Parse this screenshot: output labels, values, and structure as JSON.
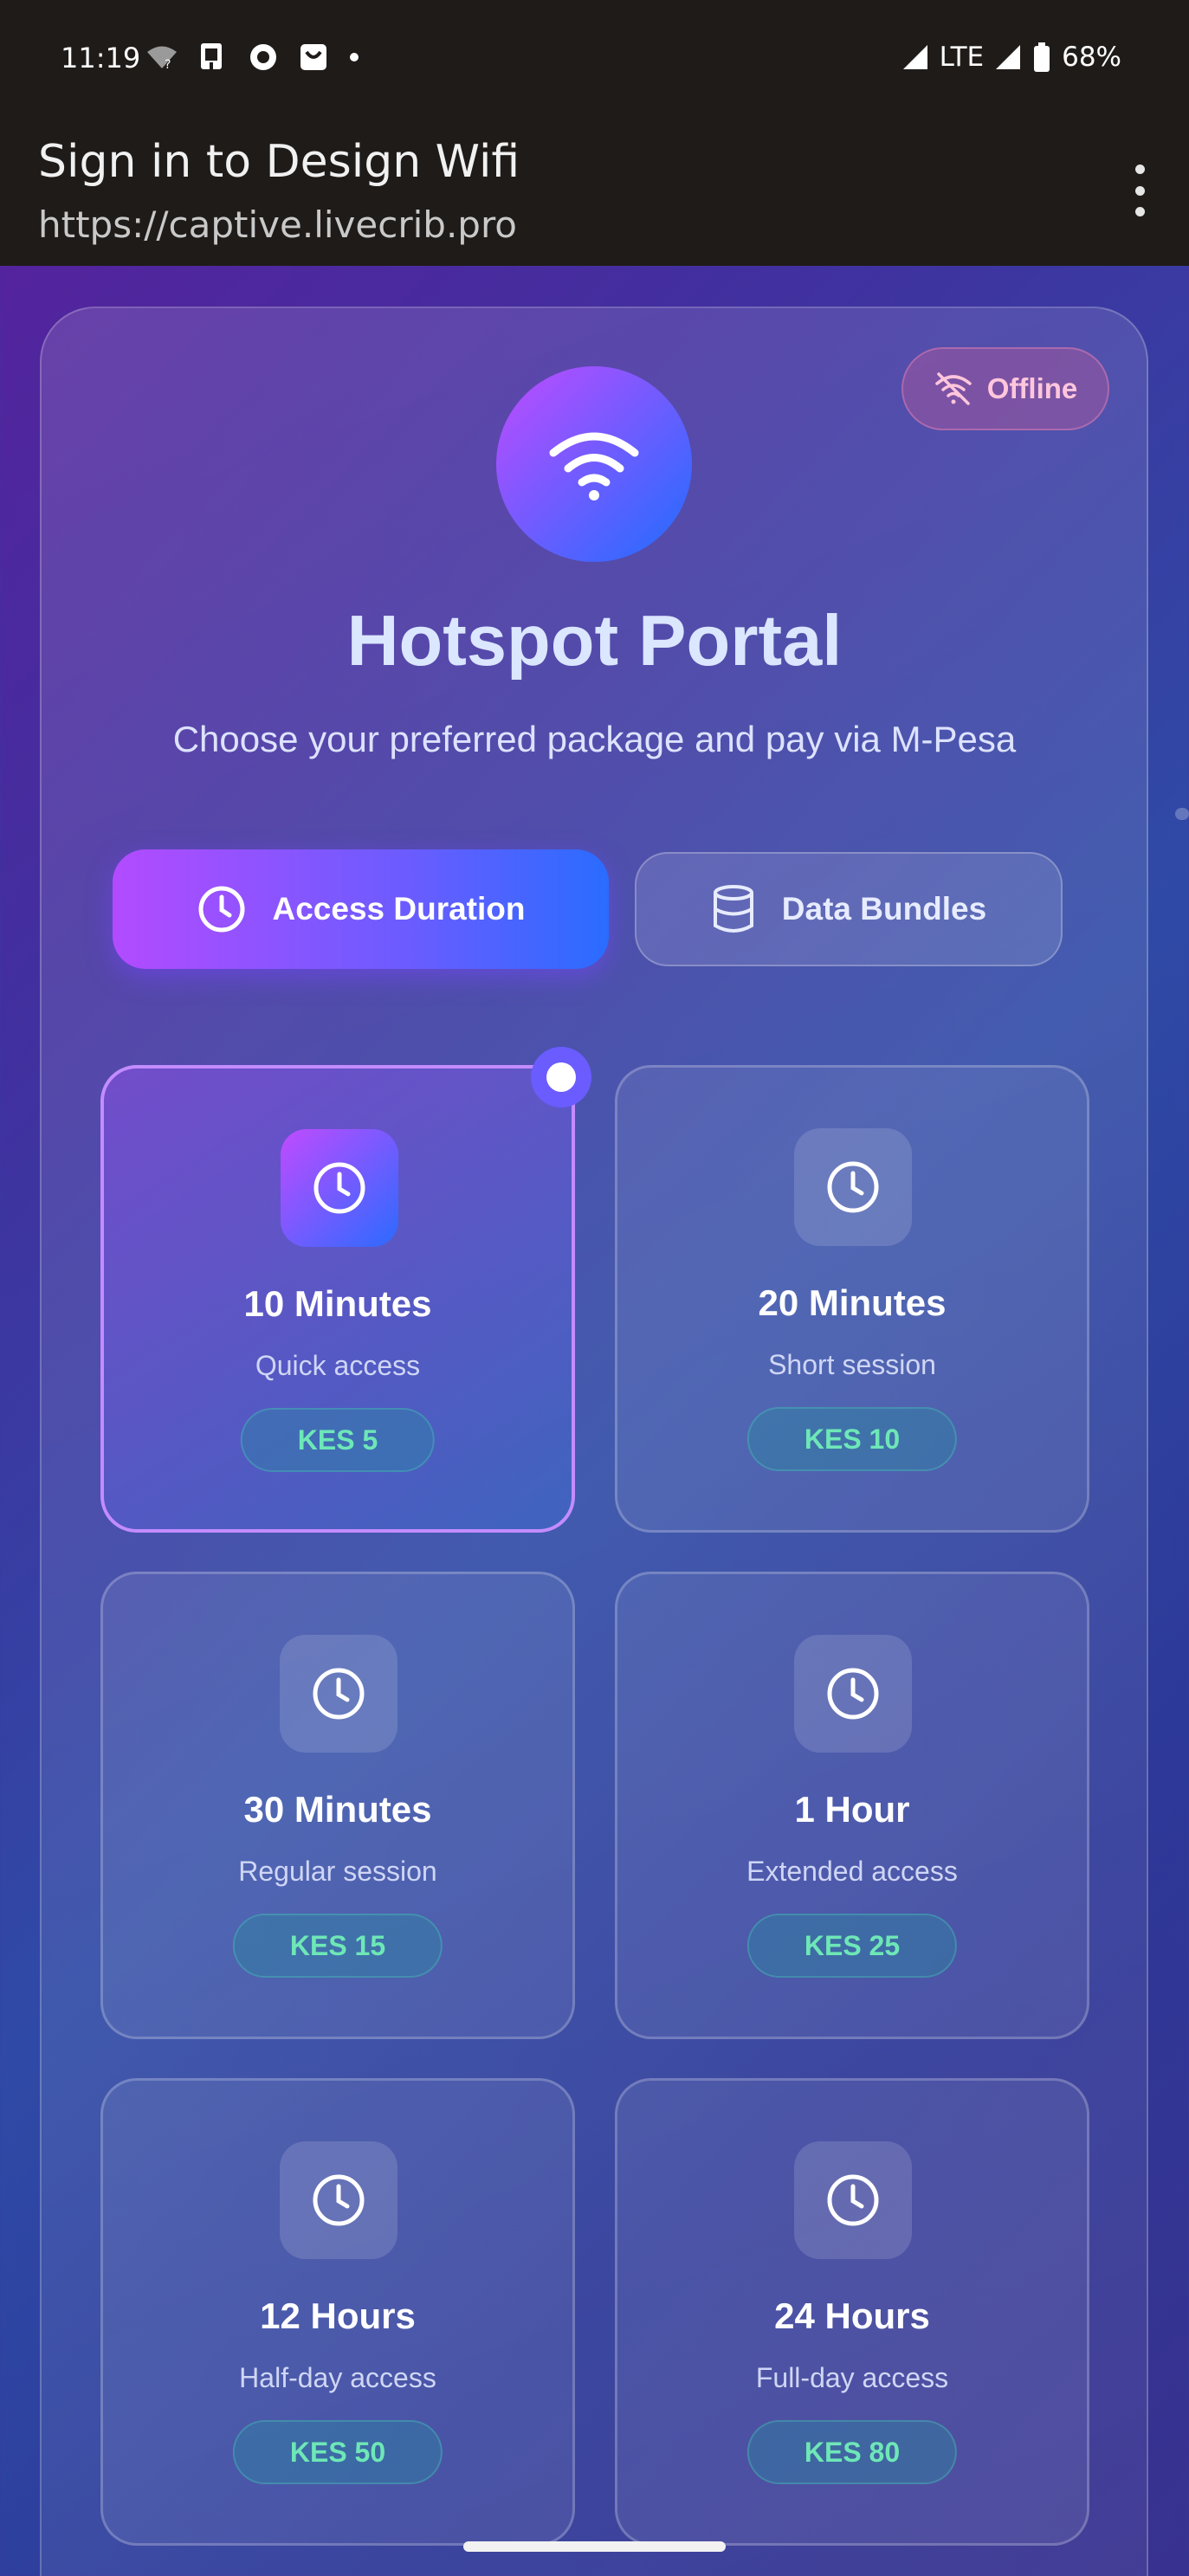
{
  "status_bar": {
    "time": "11:19",
    "network": "LTE",
    "battery": "68%"
  },
  "browser": {
    "title": "Sign in to Design Wifi",
    "url": "https://captive.livecrib.pro"
  },
  "status_badge": {
    "label": "Offline",
    "color": "#ffc6dc"
  },
  "hero": {
    "title": "Hotspot Portal",
    "subtitle": "Choose your preferred package and pay via M-Pesa"
  },
  "tabs": [
    {
      "label": "Access Duration",
      "icon": "clock-icon",
      "active": true
    },
    {
      "label": "Data Bundles",
      "icon": "database-icon",
      "active": false
    }
  ],
  "packages": [
    {
      "name": "10 Minutes",
      "description": "Quick access",
      "price": "KES 5",
      "selected": true
    },
    {
      "name": "20 Minutes",
      "description": "Short session",
      "price": "KES 10",
      "selected": false
    },
    {
      "name": "30 Minutes",
      "description": "Regular session",
      "price": "KES 15",
      "selected": false
    },
    {
      "name": "1 Hour",
      "description": "Extended access",
      "price": "KES 25",
      "selected": false
    },
    {
      "name": "12 Hours",
      "description": "Half-day access",
      "price": "KES 50",
      "selected": false
    },
    {
      "name": "24 Hours",
      "description": "Full-day access",
      "price": "KES 80",
      "selected": false
    }
  ],
  "colors": {
    "accent_start": "#c04bff",
    "accent_end": "#1f6dff",
    "price_text": "#6ee7b7"
  }
}
